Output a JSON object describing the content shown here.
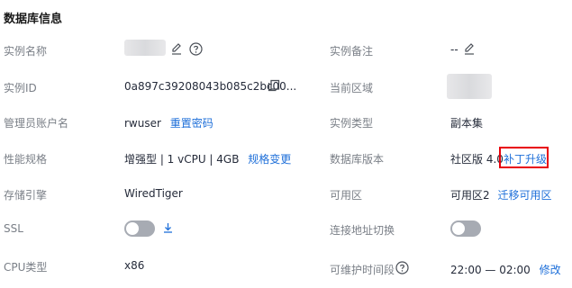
{
  "section_title": "数据库信息",
  "left": {
    "instance_name": {
      "label": "实例名称"
    },
    "instance_id": {
      "label": "实例ID",
      "value": "0a897c39208043b085c2bc00..."
    },
    "admin_account": {
      "label": "管理员账户名",
      "value": "rwuser",
      "action": "重置密码"
    },
    "spec": {
      "label": "性能规格",
      "value": "增强型 | 1 vCPU | 4GB",
      "action": "规格变更"
    },
    "storage_engine": {
      "label": "存储引擎",
      "value": "WiredTiger"
    },
    "ssl": {
      "label": "SSL"
    },
    "cpu_type": {
      "label": "CPU类型",
      "value": "x86"
    }
  },
  "right": {
    "instance_remark": {
      "label": "实例备注",
      "value": "--"
    },
    "current_region": {
      "label": "当前区域"
    },
    "instance_type": {
      "label": "实例类型",
      "value": "副本集"
    },
    "db_version": {
      "label": "数据库版本",
      "value": "社区版 4.0",
      "action": "补丁升级"
    },
    "az": {
      "label": "可用区",
      "value": "可用区2",
      "action": "迁移可用区"
    },
    "addr_switch": {
      "label": "连接地址切换"
    },
    "maintenance": {
      "label": "可维护时间段",
      "value": "22:00 — 02:00",
      "action": "修改"
    }
  },
  "colors": {
    "link": "#1e6fd9",
    "highlight": "#e8000b",
    "toggle_off": "#a7abb3"
  },
  "icons": [
    "edit-icon",
    "help-icon",
    "copy-icon",
    "download-icon"
  ]
}
